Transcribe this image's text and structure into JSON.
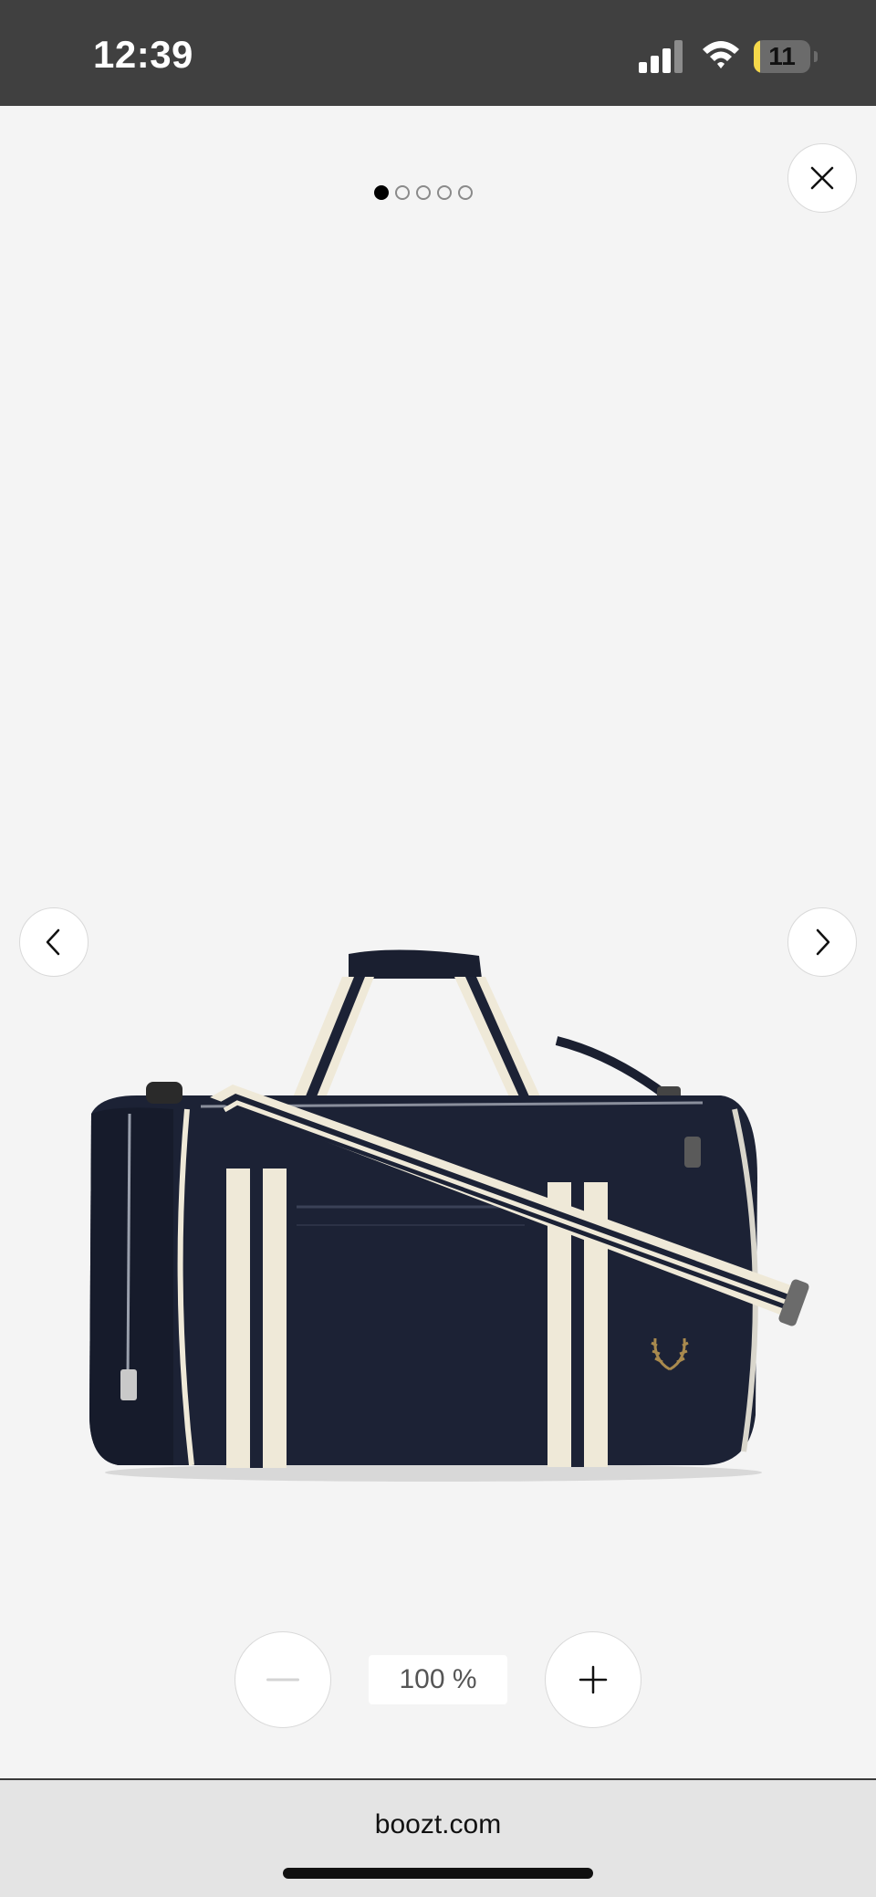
{
  "status_bar": {
    "time": "12:39",
    "battery_level": "11",
    "icons": [
      "signal-icon",
      "wifi-icon",
      "battery-icon"
    ]
  },
  "viewer": {
    "pagination": {
      "total": 5,
      "active_index": 0
    },
    "icons": {
      "close": "close-icon",
      "prev": "chevron-left-icon",
      "next": "chevron-right-icon",
      "zoom_out": "minus-icon",
      "zoom_in": "plus-icon"
    },
    "product_image_name": "navy-barrel-bag-image",
    "zoom_level": "100 %"
  },
  "browser": {
    "url": "boozt.com"
  },
  "colors": {
    "background": "#f4f4f4",
    "status_bar": "#404040",
    "bag_navy": "#1c2235",
    "bag_cream": "#efe9d8",
    "logo_gold": "#a98a4e"
  }
}
